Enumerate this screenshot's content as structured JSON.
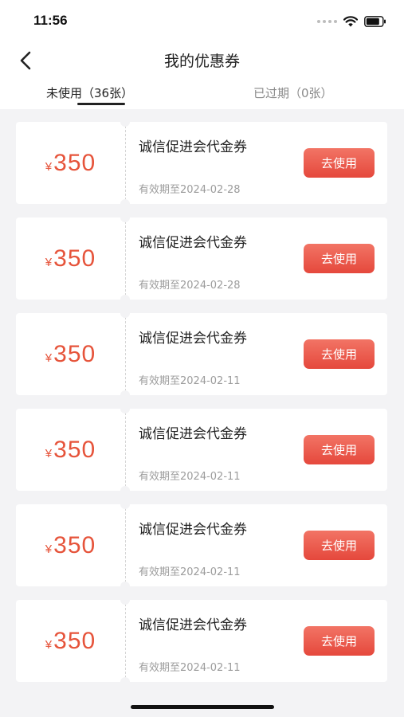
{
  "status_bar": {
    "time": "11:56"
  },
  "header": {
    "title": "我的优惠券"
  },
  "tabs": [
    {
      "label": "未使用（36张）",
      "active": true
    },
    {
      "label": "已过期（0张）",
      "active": false
    }
  ],
  "coupons": [
    {
      "currency": "¥",
      "amount": "350",
      "name": "诚信促进会代金券",
      "validity": "有效期至2024-02-28",
      "button": "去使用"
    },
    {
      "currency": "¥",
      "amount": "350",
      "name": "诚信促进会代金券",
      "validity": "有效期至2024-02-28",
      "button": "去使用"
    },
    {
      "currency": "¥",
      "amount": "350",
      "name": "诚信促进会代金券",
      "validity": "有效期至2024-02-11",
      "button": "去使用"
    },
    {
      "currency": "¥",
      "amount": "350",
      "name": "诚信促进会代金券",
      "validity": "有效期至2024-02-11",
      "button": "去使用"
    },
    {
      "currency": "¥",
      "amount": "350",
      "name": "诚信促进会代金券",
      "validity": "有效期至2024-02-11",
      "button": "去使用"
    },
    {
      "currency": "¥",
      "amount": "350",
      "name": "诚信促进会代金券",
      "validity": "有效期至2024-02-11",
      "button": "去使用"
    }
  ],
  "colors": {
    "accent": "#e6543b",
    "button_top": "#f27465",
    "button_bottom": "#e5483c",
    "background": "#f3f3f5"
  }
}
